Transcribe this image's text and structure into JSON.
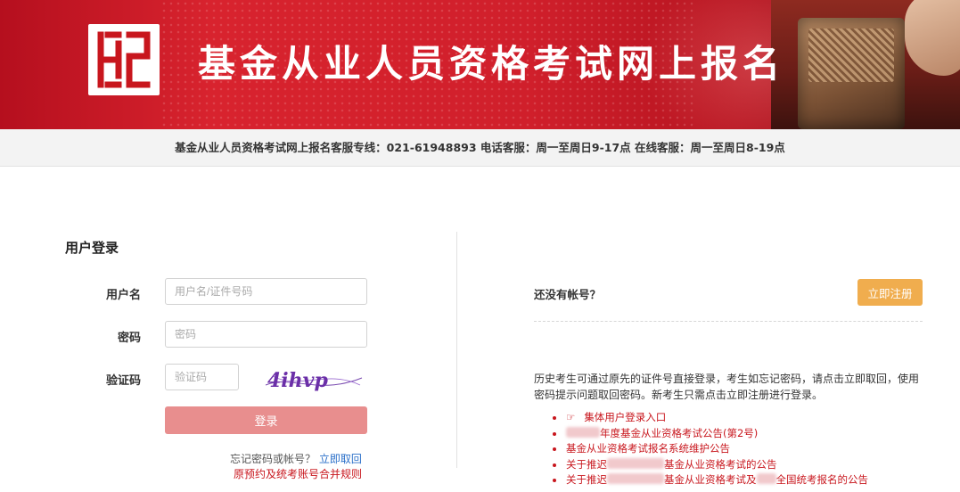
{
  "banner": {
    "title": "基金从业人员资格考试网上报名",
    "logo": "基金业协会徽标",
    "brand_color": "#d01f2b"
  },
  "hotline": {
    "text": "基金从业人员资格考试网上报名客服专线：021-61948893 电话客服：周一至周日9-17点 在线客服：周一至周日8-19点"
  },
  "login": {
    "heading": "用户登录",
    "username_label": "用户名",
    "username_placeholder": "用户名/证件号码",
    "password_label": "密码",
    "password_placeholder": "密码",
    "captcha_label": "验证码",
    "captcha_placeholder": "验证码",
    "captcha_text": "4ihvp",
    "login_button": "登录",
    "forgot_prefix": "忘记密码或帐号？",
    "forgot_link": "立即取回",
    "merge_rule_link": "原预约及统考账号合并规则"
  },
  "register": {
    "no_account": "还没有帐号？",
    "register_button": "立即注册",
    "info_text": "历史考生可通过原先的证件号直接登录，考生如忘记密码，请点击立即取回，使用密码提示问题取回密码。新考生只需点击立即注册进行登录。",
    "notices": [
      {
        "icon": "pointing-hand-icon",
        "text": "集体用户登录入口"
      },
      {
        "text": "年度基金从业资格考试公告(第2号)"
      },
      {
        "text": "基金从业资格考试报名系统维护公告"
      },
      {
        "text_a": "关于推迟",
        "text_b": "基金从业资格考试的公告"
      },
      {
        "text_a": "关于推迟",
        "text_b": "基金从业资格考试及",
        "text_c": "全国统考报名的公告"
      }
    ]
  }
}
